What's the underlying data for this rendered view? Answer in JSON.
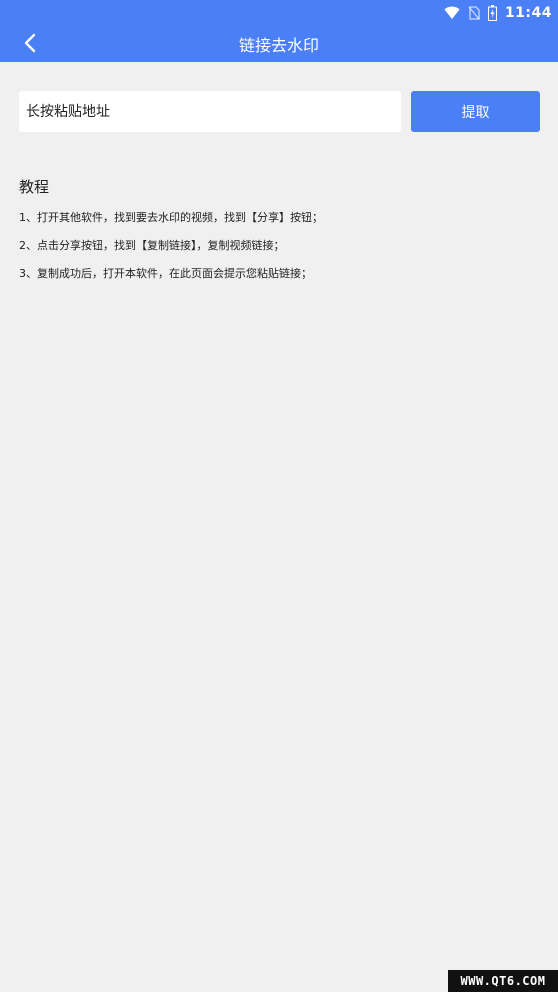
{
  "status_bar": {
    "time": "11:44"
  },
  "header": {
    "title": "链接去水印"
  },
  "search": {
    "placeholder": "长按粘贴地址",
    "button_label": "提取"
  },
  "tutorial": {
    "title": "教程",
    "steps": [
      "1、打开其他软件，找到要去水印的视频，找到【分享】按钮；",
      "2、点击分享按钮，找到【复制链接】，复制视频链接；",
      "3、复制成功后，打开本软件，在此页面会提示您粘贴链接；"
    ]
  },
  "watermark": {
    "text": "WWW.QT6.COM"
  },
  "colors": {
    "accent": "#4a7ff5",
    "background": "#f0f0f0"
  }
}
